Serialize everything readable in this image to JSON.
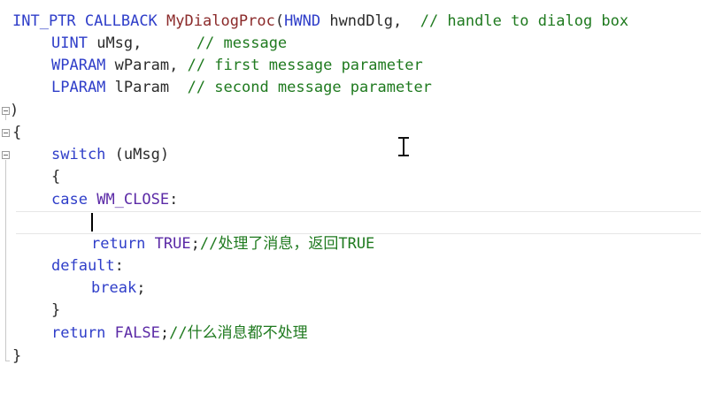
{
  "code": {
    "l1": {
      "ret": "INT_PTR",
      "cb": "CALLBACK",
      "fn": "MyDialogProc",
      "open": "(",
      "t": "HWND",
      "p": "hwndDlg",
      "comma": ",",
      "cm": "// handle to dialog box"
    },
    "l2": {
      "t": "UINT",
      "p": "uMsg,",
      "cm": "// message"
    },
    "l3": {
      "t": "WPARAM",
      "p": "wParam,",
      "cm": "// first message parameter"
    },
    "l4": {
      "t": "LPARAM",
      "p": "lParam",
      "cm": "// second message parameter"
    },
    "l5": {
      "close": ")"
    },
    "l6": {
      "brace": "{"
    },
    "l7": {
      "kw": "switch",
      "rest": "(uMsg)"
    },
    "l8": {
      "brace": "{"
    },
    "l9": {
      "kw": "case",
      "cn": "WM_CLOSE",
      "colon": ":"
    },
    "l11": {
      "kw": "return",
      "val": "TRUE",
      "semi": ";",
      "cm": "//处理了消息，返回TRUE"
    },
    "l12": {
      "kw": "default",
      "colon": ":"
    },
    "l13": {
      "kw": "break",
      "semi": ";"
    },
    "l14": {
      "brace": "}"
    },
    "l15": {
      "kw": "return",
      "val": "FALSE",
      "semi": ";",
      "cm": "//什么消息都不处理"
    },
    "l16": {
      "brace": "}"
    }
  },
  "icons": {
    "fold": "collapse-box-icon",
    "cursor": "ibeam-cursor-icon"
  },
  "colors": {
    "keyword": "#2f3ec9",
    "function": "#8b2a2a",
    "comment": "#1f7a1f",
    "constant": "#5b2aa6",
    "text": "#2b2b2b"
  }
}
